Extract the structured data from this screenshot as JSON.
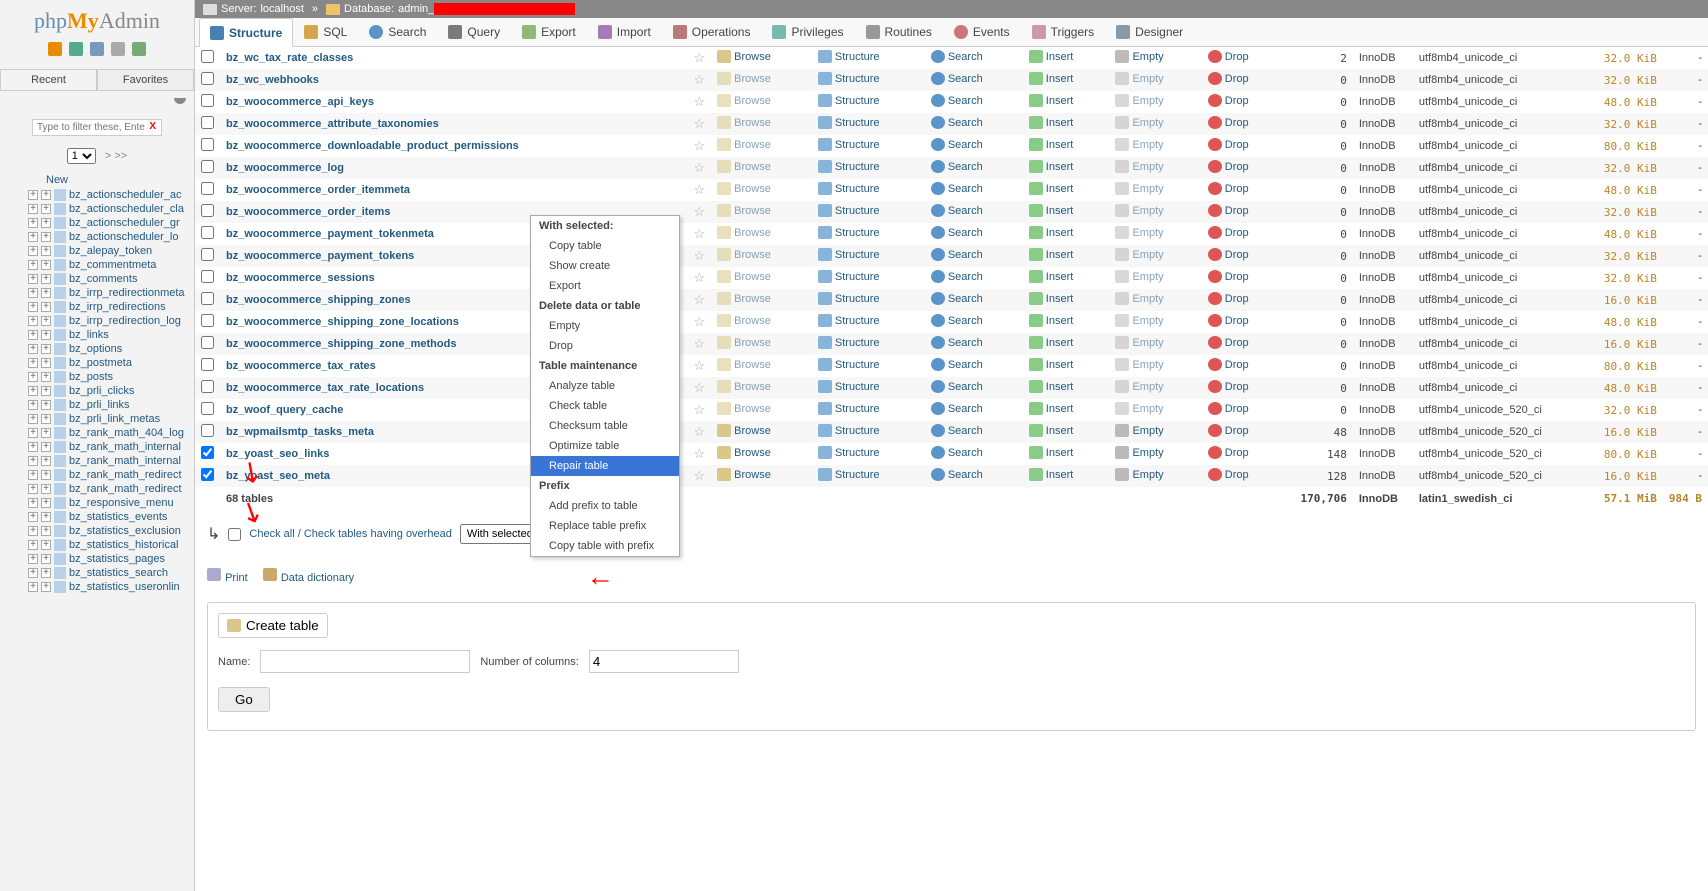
{
  "logo": {
    "php": "php",
    "my": "My",
    "admin": "Admin"
  },
  "sidebar": {
    "tabs": {
      "recent": "Recent",
      "favorites": "Favorites"
    },
    "filter_placeholder": "Type to filter these, Ente",
    "pager": {
      "current": "1",
      "arrows": "> >>"
    },
    "new_label": "New",
    "tree": [
      "bz_actionscheduler_ac",
      "bz_actionscheduler_cla",
      "bz_actionscheduler_gr",
      "bz_actionscheduler_lo",
      "bz_alepay_token",
      "bz_commentmeta",
      "bz_comments",
      "bz_irrp_redirectionmeta",
      "bz_irrp_redirections",
      "bz_irrp_redirection_log",
      "bz_links",
      "bz_options",
      "bz_postmeta",
      "bz_posts",
      "bz_prli_clicks",
      "bz_prli_links",
      "bz_prli_link_metas",
      "bz_rank_math_404_log",
      "bz_rank_math_internal",
      "bz_rank_math_internal",
      "bz_rank_math_redirect",
      "bz_rank_math_redirect",
      "bz_responsive_menu",
      "bz_statistics_events",
      "bz_statistics_exclusion",
      "bz_statistics_historical",
      "bz_statistics_pages",
      "bz_statistics_search",
      "bz_statistics_useronlin"
    ]
  },
  "breadcrumb": {
    "server_label": "Server:",
    "server": "localhost",
    "db_label": "Database:",
    "db_prefix": "admin_"
  },
  "tabs": [
    "Structure",
    "SQL",
    "Search",
    "Query",
    "Export",
    "Import",
    "Operations",
    "Privileges",
    "Routines",
    "Events",
    "Triggers",
    "Designer"
  ],
  "actions": {
    "browse": "Browse",
    "structure": "Structure",
    "search": "Search",
    "insert": "Insert",
    "empty": "Empty",
    "drop": "Drop"
  },
  "tables": [
    {
      "name": "bz_wc_tax_rate_classes",
      "rows": 2,
      "engine": "InnoDB",
      "coll": "utf8mb4_unicode_ci",
      "size": "32.0 KiB",
      "ov": "-",
      "chk": false
    },
    {
      "name": "bz_wc_webhooks",
      "rows": 0,
      "engine": "InnoDB",
      "coll": "utf8mb4_unicode_ci",
      "size": "32.0 KiB",
      "ov": "-",
      "chk": false
    },
    {
      "name": "bz_woocommerce_api_keys",
      "rows": 0,
      "engine": "InnoDB",
      "coll": "utf8mb4_unicode_ci",
      "size": "48.0 KiB",
      "ov": "-",
      "chk": false
    },
    {
      "name": "bz_woocommerce_attribute_taxonomies",
      "rows": 0,
      "engine": "InnoDB",
      "coll": "utf8mb4_unicode_ci",
      "size": "32.0 KiB",
      "ov": "-",
      "chk": false
    },
    {
      "name": "bz_woocommerce_downloadable_product_permissions",
      "rows": 0,
      "engine": "InnoDB",
      "coll": "utf8mb4_unicode_ci",
      "size": "80.0 KiB",
      "ov": "-",
      "chk": false
    },
    {
      "name": "bz_woocommerce_log",
      "rows": 0,
      "engine": "InnoDB",
      "coll": "utf8mb4_unicode_ci",
      "size": "32.0 KiB",
      "ov": "-",
      "chk": false
    },
    {
      "name": "bz_woocommerce_order_itemmeta",
      "rows": 0,
      "engine": "InnoDB",
      "coll": "utf8mb4_unicode_ci",
      "size": "48.0 KiB",
      "ov": "-",
      "chk": false
    },
    {
      "name": "bz_woocommerce_order_items",
      "rows": 0,
      "engine": "InnoDB",
      "coll": "utf8mb4_unicode_ci",
      "size": "32.0 KiB",
      "ov": "-",
      "chk": false
    },
    {
      "name": "bz_woocommerce_payment_tokenmeta",
      "rows": 0,
      "engine": "InnoDB",
      "coll": "utf8mb4_unicode_ci",
      "size": "48.0 KiB",
      "ov": "-",
      "chk": false
    },
    {
      "name": "bz_woocommerce_payment_tokens",
      "rows": 0,
      "engine": "InnoDB",
      "coll": "utf8mb4_unicode_ci",
      "size": "32.0 KiB",
      "ov": "-",
      "chk": false
    },
    {
      "name": "bz_woocommerce_sessions",
      "rows": 0,
      "engine": "InnoDB",
      "coll": "utf8mb4_unicode_ci",
      "size": "32.0 KiB",
      "ov": "-",
      "chk": false
    },
    {
      "name": "bz_woocommerce_shipping_zones",
      "rows": 0,
      "engine": "InnoDB",
      "coll": "utf8mb4_unicode_ci",
      "size": "16.0 KiB",
      "ov": "-",
      "chk": false
    },
    {
      "name": "bz_woocommerce_shipping_zone_locations",
      "rows": 0,
      "engine": "InnoDB",
      "coll": "utf8mb4_unicode_ci",
      "size": "48.0 KiB",
      "ov": "-",
      "chk": false
    },
    {
      "name": "bz_woocommerce_shipping_zone_methods",
      "rows": 0,
      "engine": "InnoDB",
      "coll": "utf8mb4_unicode_ci",
      "size": "16.0 KiB",
      "ov": "-",
      "chk": false
    },
    {
      "name": "bz_woocommerce_tax_rates",
      "rows": 0,
      "engine": "InnoDB",
      "coll": "utf8mb4_unicode_ci",
      "size": "80.0 KiB",
      "ov": "-",
      "chk": false
    },
    {
      "name": "bz_woocommerce_tax_rate_locations",
      "rows": 0,
      "engine": "InnoDB",
      "coll": "utf8mb4_unicode_ci",
      "size": "48.0 KiB",
      "ov": "-",
      "chk": false
    },
    {
      "name": "bz_woof_query_cache",
      "rows": 0,
      "engine": "InnoDB",
      "coll": "utf8mb4_unicode_520_ci",
      "size": "32.0 KiB",
      "ov": "-",
      "chk": false
    },
    {
      "name": "bz_wpmailsmtp_tasks_meta",
      "rows": 48,
      "engine": "InnoDB",
      "coll": "utf8mb4_unicode_520_ci",
      "size": "16.0 KiB",
      "ov": "-",
      "chk": false
    },
    {
      "name": "bz_yoast_seo_links",
      "rows": 148,
      "engine": "InnoDB",
      "coll": "utf8mb4_unicode_520_ci",
      "size": "80.0 KiB",
      "ov": "-",
      "chk": true
    },
    {
      "name": "bz_yoast_seo_meta",
      "rows": 128,
      "engine": "InnoDB",
      "coll": "utf8mb4_unicode_520_ci",
      "size": "16.0 KiB",
      "ov": "-",
      "chk": true
    }
  ],
  "totals": {
    "count": "68 tables",
    "rows": "170,706",
    "engine": "InnoDB",
    "coll": "latin1_swedish_ci",
    "size": "57.1 MiB",
    "ov": "984 B"
  },
  "check_all": {
    "all": "Check all",
    "overhead": "Check tables having overhead",
    "sep": " / "
  },
  "with_selected": "With selected:",
  "menu": {
    "hdr1": "With selected:",
    "copy": "Copy table",
    "show": "Show create",
    "export": "Export",
    "hdr2": "Delete data or table",
    "empty": "Empty",
    "drop": "Drop",
    "hdr3": "Table maintenance",
    "analyze": "Analyze table",
    "check": "Check table",
    "checksum": "Checksum table",
    "optimize": "Optimize table",
    "repair": "Repair table",
    "hdr4": "Prefix",
    "addp": "Add prefix to table",
    "repl": "Replace table prefix",
    "copyp": "Copy table with prefix"
  },
  "print": "Print",
  "dict": "Data dictionary",
  "create": {
    "btn": "Create table",
    "name_label": "Name:",
    "cols_label": "Number of columns:",
    "cols_value": "4"
  },
  "go": "Go"
}
